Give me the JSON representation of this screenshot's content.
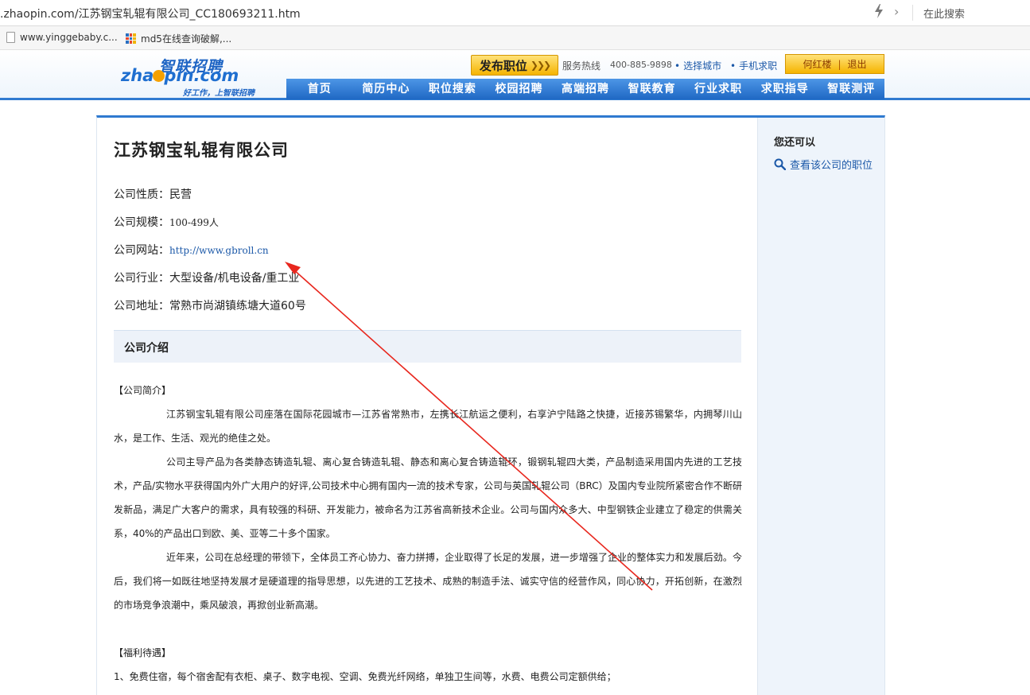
{
  "browser": {
    "url": ".zhaopin.com/江苏钢宝轧辊有限公司_CC180693211.htm",
    "search_placeholder": "在此搜索",
    "bookmarks": [
      {
        "label": "www.yinggebaby.c..."
      },
      {
        "label": "md5在线查询破解,..."
      }
    ]
  },
  "header": {
    "logo_cn": "智联招聘",
    "logo_en_pre": "zha",
    "logo_en_post": "pin.com",
    "logo_slogan": "好工作，上智联招聘",
    "post_job_label": "发布职位",
    "hotline_label": "服务热线",
    "hotline_number": "400-885-9898",
    "select_city": "选择城市",
    "mobile_job": "手机求职",
    "username": "何红楼",
    "logout": "退出",
    "nav": [
      "首页",
      "简历中心",
      "职位搜索",
      "校园招聘",
      "高端招聘",
      "智联教育",
      "行业求职",
      "求职指导",
      "智联测评"
    ]
  },
  "company": {
    "name": "江苏钢宝轧辊有限公司",
    "nature_label": "公司性质：",
    "nature_value": "民营",
    "size_label": "公司规模：",
    "size_value": "100-499人",
    "website_label": "公司网站：",
    "website_value": "http://www.gbroll.cn",
    "industry_label": "公司行业：",
    "industry_value": "大型设备/机电设备/重工业",
    "address_label": "公司地址：",
    "address_value": "常熟市尚湖镇练塘大道60号"
  },
  "intro": {
    "heading": "公司介绍",
    "section1_title": "【公司简介】",
    "para1": "江苏钢宝轧辊有限公司座落在国际花园城市—江苏省常熟市，左携长江航运之便利，右享沪宁陆路之快捷，近接苏锡繁华，内拥琴川山水，是工作、生活、观光的绝佳之处。",
    "para2": "公司主导产品为各类静态铸造轧辊、离心复合铸造轧辊、静态和离心复合铸造辊环，锻钢轧辊四大类，产品制造采用国内先进的工艺技术，产品/实物水平获得国内外广大用户的好评,公司技术中心拥有国内一流的技术专家，公司与英国轧辊公司（BRC）及国内专业院所紧密合作不断研发新品，满足广大客户的需求，具有较强的科研、开发能力，被命名为江苏省高新技术企业。公司与国内众多大、中型钢铁企业建立了稳定的供需关系，40%的产品出口到欧、美、亚等二十多个国家。",
    "para3": "近年来，公司在总经理的带领下，全体员工齐心协力、奋力拼搏，企业取得了长足的发展，进一步增强了企业的整体实力和发展后劲。今后，我们将一如既往地坚持发展才是硬道理的指导思想，以先进的工艺技术、成熟的制造手法、诚实守信的经营作风，同心协力，开拓创新，在激烈的市场竞争浪潮中，乘风破浪，再掀创业新高潮。",
    "section2_title": "【福利待遇】",
    "benefit1": "1、免费住宿，每个宿舍配有衣柜、桌子、数字电视、空调、免费光纤网络，单独卫生间等，水费、电费公司定额供给；"
  },
  "sidebar": {
    "title": "您还可以",
    "view_jobs": "查看该公司的职位"
  },
  "colors": {
    "brand_blue": "#2f7ad0",
    "link_blue": "#1b58a8",
    "accent_yellow": "#f5b400",
    "annotation_red": "#e8271e"
  }
}
